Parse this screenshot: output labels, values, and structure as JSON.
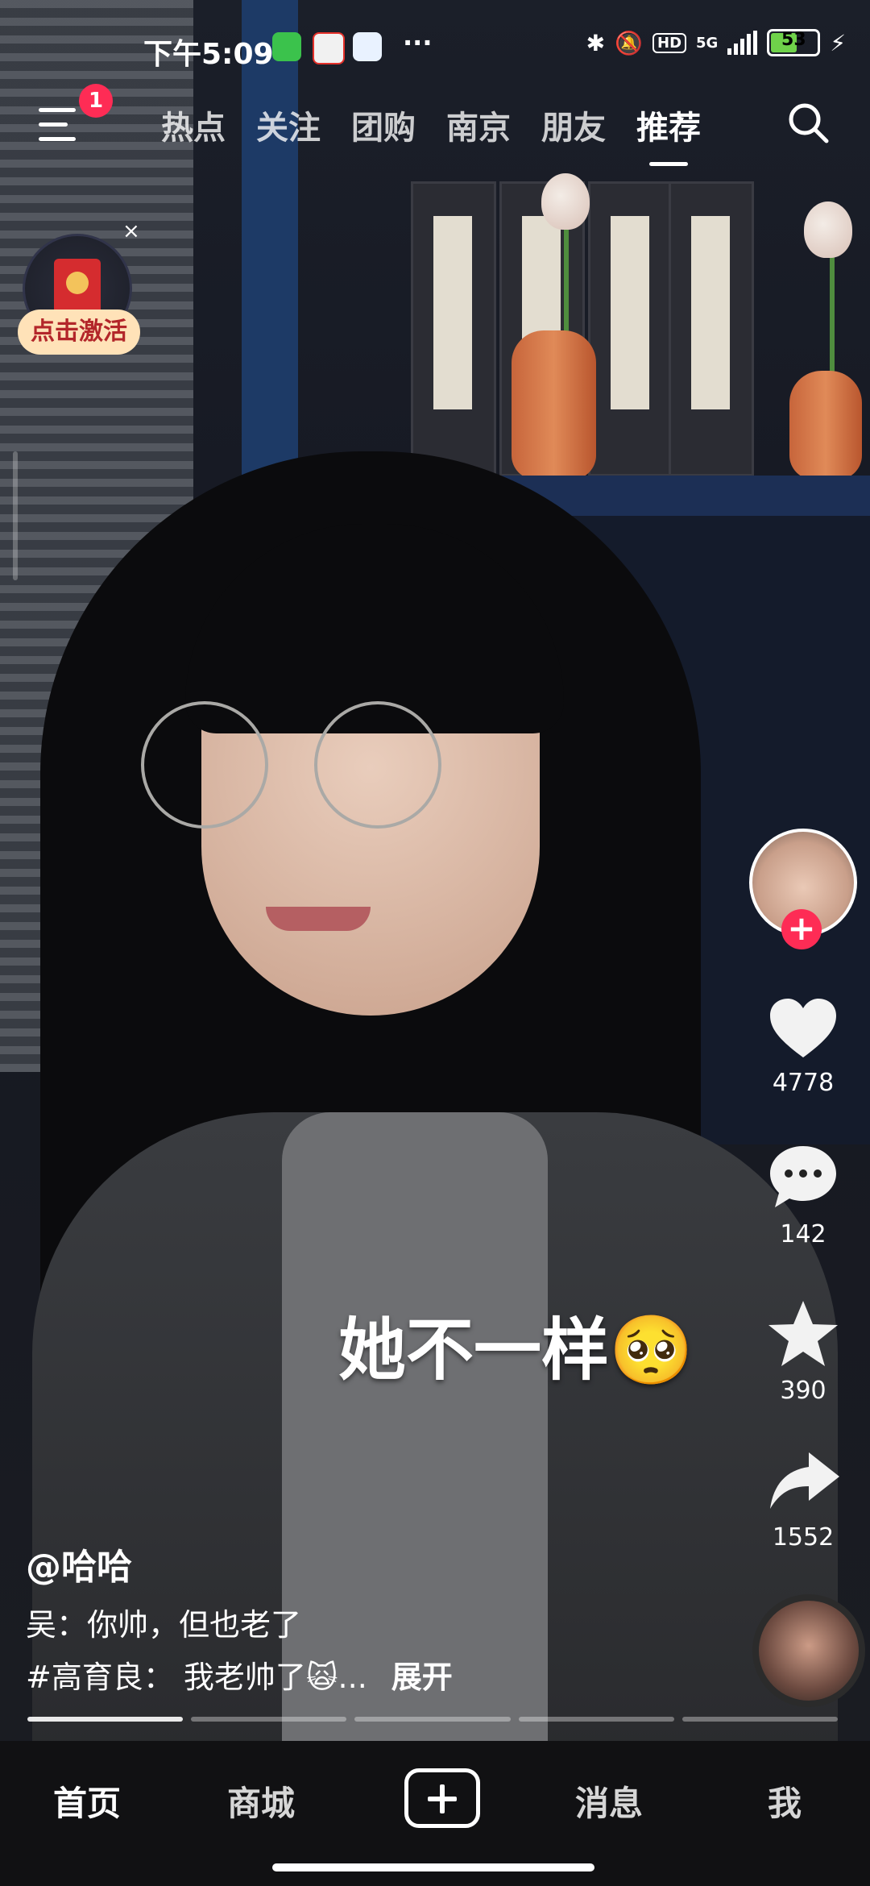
{
  "status_bar": {
    "time": "下午5:09",
    "network": "5G",
    "hd_label": "HD",
    "battery": "53"
  },
  "top_nav": {
    "badge_count": "1",
    "tabs": [
      "热点",
      "关注",
      "团购",
      "南京",
      "朋友",
      "推荐"
    ],
    "active_tab": "推荐"
  },
  "red_packet": {
    "label": "点击激活",
    "close": "×"
  },
  "video": {
    "overlay_text": "她不一样🥺",
    "author": "@哈哈",
    "description_line1": "吴：你帅，但也老了",
    "description_line2": "#高育良： 我老帅了🙀...",
    "expand_label": "展开",
    "progress_segments": 5,
    "progress_active_index": 0
  },
  "actions": {
    "likes": "4778",
    "comments": "142",
    "favorites": "390",
    "shares": "1552"
  },
  "bottom_nav": {
    "home": "首页",
    "mall": "商城",
    "messages": "消息",
    "me": "我"
  },
  "colors": {
    "accent": "#fe2c55",
    "badge_bg": "#ffe2b8",
    "badge_text": "#b3262a"
  }
}
